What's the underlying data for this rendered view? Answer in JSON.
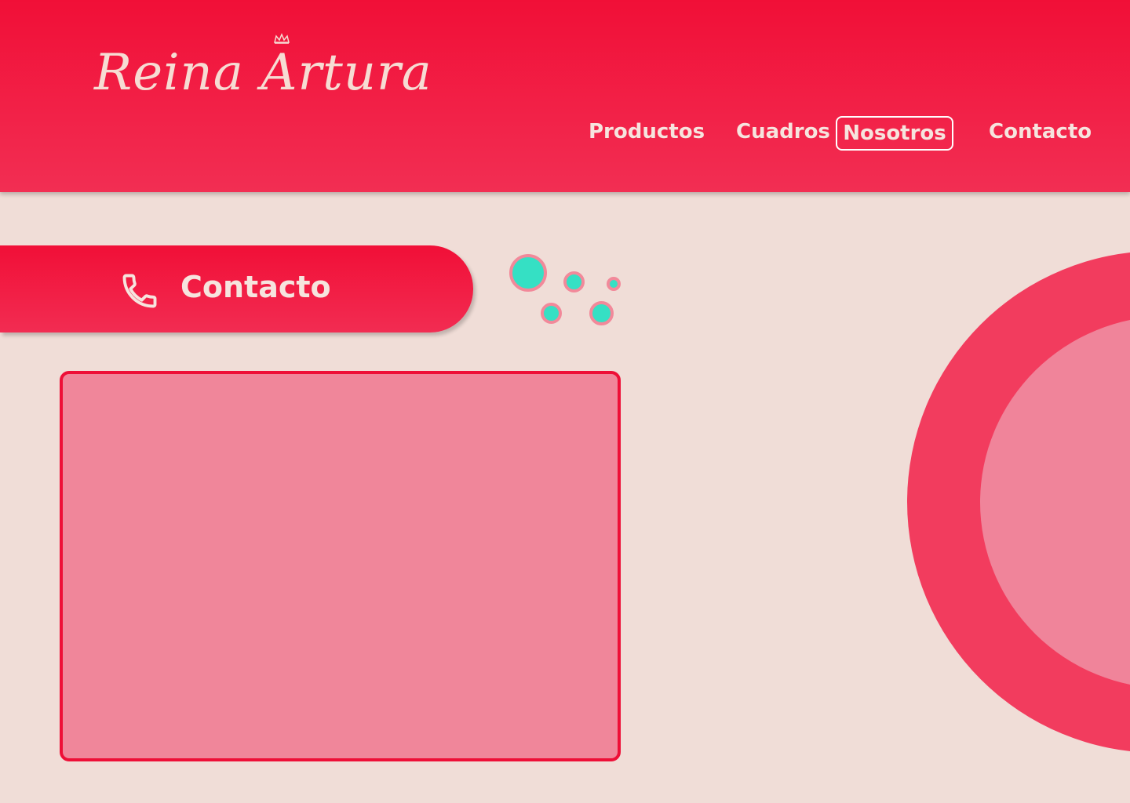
{
  "header": {
    "brand": "Reina Artura",
    "nav": {
      "productos": "Productos",
      "cuadros": "Cuadros",
      "nosotros": "Nosotros",
      "contacto": "Contacto"
    },
    "active_item": "Nosotros"
  },
  "section": {
    "title": "Contacto",
    "icon": "phone-icon"
  },
  "colors": {
    "primary": "#f10f37",
    "background": "#f0ddd7",
    "accent_teal": "#35e0c4",
    "panel_pink": "#f0869a",
    "text_light": "#f6e4de"
  }
}
